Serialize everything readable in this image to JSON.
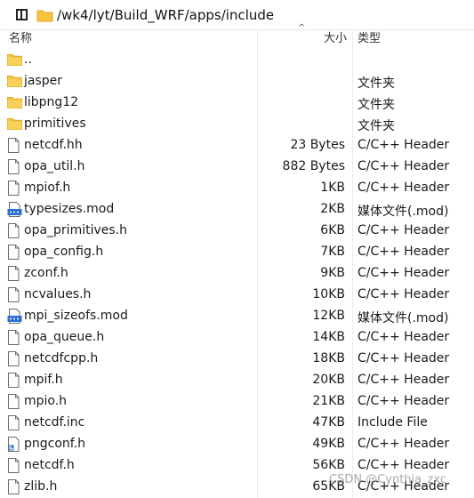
{
  "path": "/wk4/lyt/Build_WRF/apps/include",
  "columns": {
    "name": "名称",
    "size": "大小",
    "type": "类型"
  },
  "sort_indicator": "^",
  "rows": [
    {
      "name": "..",
      "size": "",
      "type": "",
      "icon": "folder-icon"
    },
    {
      "name": "jasper",
      "size": "",
      "type": "文件夹",
      "icon": "folder-icon"
    },
    {
      "name": "libpng12",
      "size": "",
      "type": "文件夹",
      "icon": "folder-icon"
    },
    {
      "name": "primitives",
      "size": "",
      "type": "文件夹",
      "icon": "folder-icon"
    },
    {
      "name": "netcdf.hh",
      "size": "23 Bytes",
      "type": "C/C++ Header",
      "icon": "file-icon"
    },
    {
      "name": "opa_util.h",
      "size": "882 Bytes",
      "type": "C/C++ Header",
      "icon": "file-icon"
    },
    {
      "name": "mpiof.h",
      "size": "1KB",
      "type": "C/C++ Header",
      "icon": "file-icon"
    },
    {
      "name": "typesizes.mod",
      "size": "2KB",
      "type": "媒体文件(.mod)",
      "icon": "media-file-icon"
    },
    {
      "name": "opa_primitives.h",
      "size": "6KB",
      "type": "C/C++ Header",
      "icon": "file-icon"
    },
    {
      "name": "opa_config.h",
      "size": "7KB",
      "type": "C/C++ Header",
      "icon": "file-icon"
    },
    {
      "name": "zconf.h",
      "size": "9KB",
      "type": "C/C++ Header",
      "icon": "file-icon"
    },
    {
      "name": "ncvalues.h",
      "size": "10KB",
      "type": "C/C++ Header",
      "icon": "file-icon"
    },
    {
      "name": "mpi_sizeofs.mod",
      "size": "12KB",
      "type": "媒体文件(.mod)",
      "icon": "media-file-icon"
    },
    {
      "name": "opa_queue.h",
      "size": "14KB",
      "type": "C/C++ Header",
      "icon": "file-icon"
    },
    {
      "name": "netcdfcpp.h",
      "size": "18KB",
      "type": "C/C++ Header",
      "icon": "file-icon"
    },
    {
      "name": "mpif.h",
      "size": "20KB",
      "type": "C/C++ Header",
      "icon": "file-icon"
    },
    {
      "name": "mpio.h",
      "size": "21KB",
      "type": "C/C++ Header",
      "icon": "file-icon"
    },
    {
      "name": "netcdf.inc",
      "size": "47KB",
      "type": "Include File",
      "icon": "file-icon"
    },
    {
      "name": "pngconf.h",
      "size": "49KB",
      "type": "C/C++ Header",
      "icon": "shortcut-file-icon"
    },
    {
      "name": "netcdf.h",
      "size": "56KB",
      "type": "C/C++ Header",
      "icon": "file-icon"
    },
    {
      "name": "zlib.h",
      "size": "65KB",
      "type": "C/C++ Header",
      "icon": "file-icon"
    }
  ],
  "watermark": "CSDN @Cynthia_zxc",
  "colors": {
    "folder": "#f5c542",
    "folder_dark": "#e0a826",
    "media": "#2b6fd1"
  }
}
